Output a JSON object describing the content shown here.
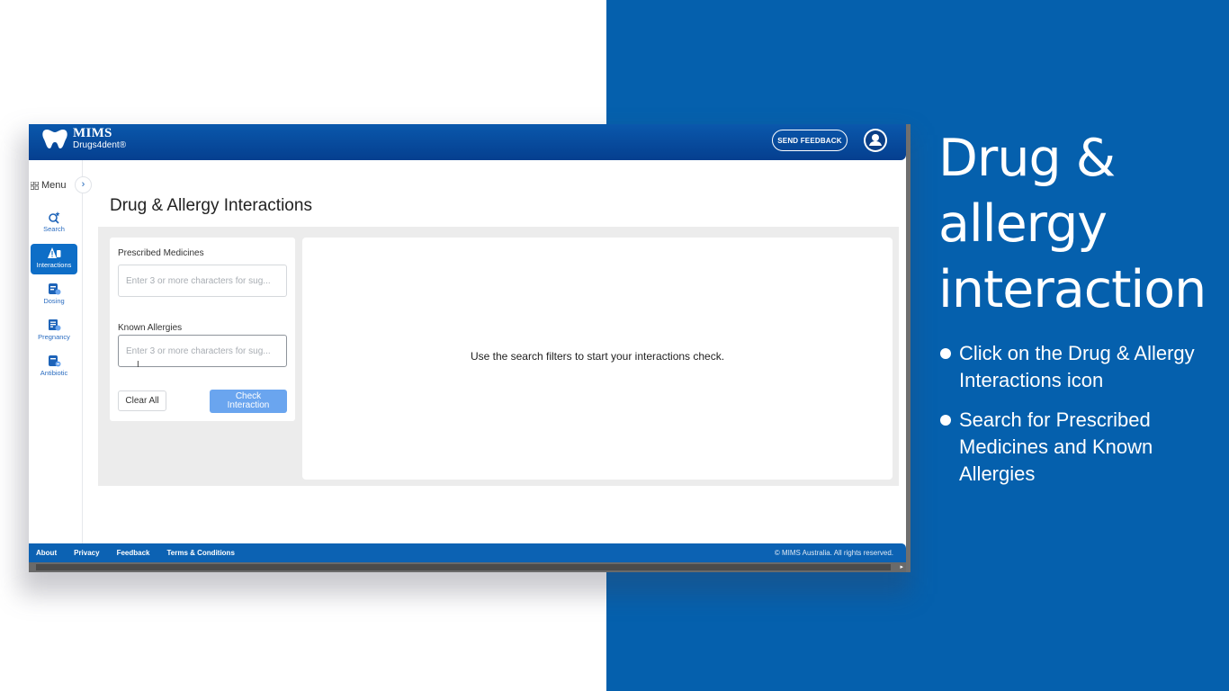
{
  "app": {
    "brand": "MIMS",
    "product": "Drugs4dent",
    "product_mark": "®",
    "send_feedback_label": "SEND FEEDBACK"
  },
  "sidebar": {
    "menu_label": "Menu",
    "items": [
      {
        "label": "Search",
        "icon": "search-icon"
      },
      {
        "label": "Interactions",
        "icon": "interactions-icon",
        "active": true
      },
      {
        "label": "Dosing",
        "icon": "dosing-icon"
      },
      {
        "label": "Pregnancy",
        "icon": "pregnancy-icon"
      },
      {
        "label": "Antibiotic",
        "icon": "antibiotic-icon"
      }
    ]
  },
  "main": {
    "title": "Drug & Allergy Interactions",
    "prescribed_label": "Prescribed Medicines",
    "prescribed_placeholder": "Enter 3 or more characters for sug...",
    "allergies_label": "Known Allergies",
    "allergies_placeholder": "Enter 3 or more characters for sug...",
    "clear_label": "Clear All",
    "check_label_line1": "Check",
    "check_label_line2": "Interaction",
    "results_message": "Use the search filters to start your interactions check."
  },
  "footer": {
    "links": [
      "About",
      "Privacy",
      "Feedback",
      "Terms & Conditions"
    ],
    "copyright": "© MIMS Australia. All rights reserved."
  },
  "slide": {
    "title_line1": "Drug &",
    "title_line2": "allergy",
    "title_line3": "interaction",
    "bullet1": "Click on the Drug & Allergy Interactions icon",
    "bullet2": "Search for Prescribed Medicines and Known Allergies"
  },
  "colors": {
    "slide_blue": "#0560ad",
    "header_blue": "#053f8f",
    "active_nav": "#0e6ec7",
    "check_button": "#6aa5ef"
  }
}
